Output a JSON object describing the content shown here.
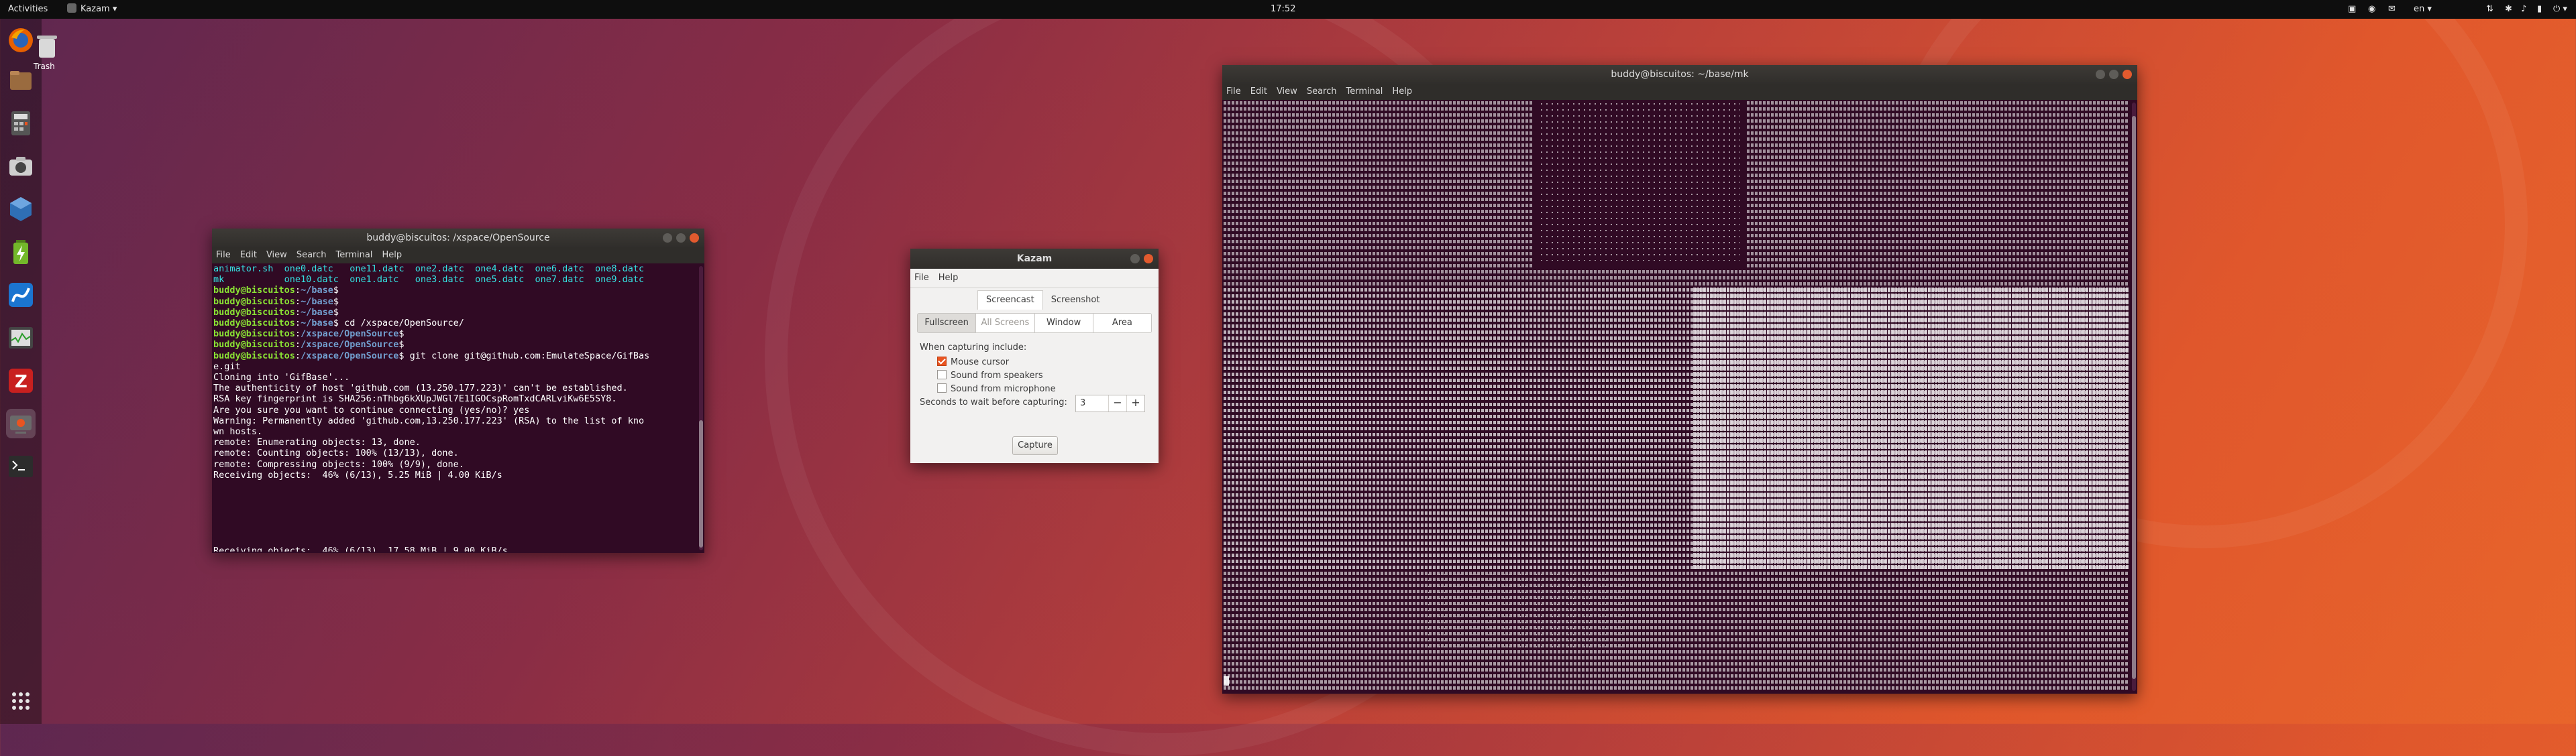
{
  "topbar": {
    "activities": "Activities",
    "app_menu": "Kazam",
    "clock": "17:52",
    "lang": "en",
    "colors": {
      "bg": "#0e0e0e",
      "text": "#e6e6e6"
    }
  },
  "desktop": {
    "trash_label": "Trash"
  },
  "dock": {
    "apps": [
      {
        "name": "firefox-icon",
        "color": "#e66000"
      },
      {
        "name": "files-icon",
        "color": "#9a6b3f"
      },
      {
        "name": "calculator-icon",
        "color": "#555555"
      },
      {
        "name": "screenshot-icon",
        "color": "#cccccc"
      },
      {
        "name": "virtualbox-icon",
        "color": "#2f6fb5"
      },
      {
        "name": "battery-icon",
        "color": "#73b82a"
      },
      {
        "name": "app-blue-icon",
        "color": "#1b75d0"
      },
      {
        "name": "system-monitor-icon",
        "color": "#444444"
      },
      {
        "name": "filezilla-icon",
        "color": "#c8201f"
      },
      {
        "name": "kazam-icon",
        "color": "#6a6a6a"
      },
      {
        "name": "terminal-icon",
        "color": "#2c2c2c"
      }
    ],
    "show_apps": "show-applications-icon"
  },
  "terminal_left": {
    "title": "buddy@biscuitos: /xspace/OpenSource",
    "menu": [
      "File",
      "Edit",
      "View",
      "Search",
      "Terminal",
      "Help"
    ],
    "lines": [
      {
        "type": "plain",
        "text": "animator.sh  one0.datc   one11.datc  one2.datc  one4.datc  one6.datc  one8.datc"
      },
      {
        "type": "plain",
        "text": "mk           one10.datc  one1.datc   one3.datc  one5.datc  one7.datc  one9.datc"
      },
      {
        "type": "prompt",
        "user": "buddy@biscuitos",
        "path": "~/base",
        "cmd": ""
      },
      {
        "type": "prompt",
        "user": "buddy@biscuitos",
        "path": "~/base",
        "cmd": ""
      },
      {
        "type": "prompt",
        "user": "buddy@biscuitos",
        "path": "~/base",
        "cmd": ""
      },
      {
        "type": "prompt",
        "user": "buddy@biscuitos",
        "path": "~/base",
        "cmd": " cd /xspace/OpenSource/"
      },
      {
        "type": "prompt",
        "user": "buddy@biscuitos",
        "path": "/xspace/OpenSource",
        "cmd": ""
      },
      {
        "type": "prompt",
        "user": "buddy@biscuitos",
        "path": "/xspace/OpenSource",
        "cmd": ""
      },
      {
        "type": "prompt",
        "user": "buddy@biscuitos",
        "path": "/xspace/OpenSource",
        "cmd": " git clone git@github.com:EmulateSpace/GifBas"
      },
      {
        "type": "plain",
        "text": "e.git"
      },
      {
        "type": "plain",
        "text": "Cloning into 'GifBase'..."
      },
      {
        "type": "plain",
        "text": "The authenticity of host 'github.com (13.250.177.223)' can't be established."
      },
      {
        "type": "plain",
        "text": "RSA key fingerprint is SHA256:nThbg6kXUpJWGl7E1IGOCspRomTxdCARLviKw6E5SY8."
      },
      {
        "type": "plain",
        "text": "Are you sure you want to continue connecting (yes/no)? yes"
      },
      {
        "type": "plain",
        "text": "Warning: Permanently added 'github.com,13.250.177.223' (RSA) to the list of kno"
      },
      {
        "type": "plain",
        "text": "wn hosts."
      },
      {
        "type": "plain",
        "text": "remote: Enumerating objects: 13, done."
      },
      {
        "type": "plain",
        "text": "remote: Counting objects: 100% (13/13), done."
      },
      {
        "type": "plain",
        "text": "remote: Compressing objects: 100% (9/9), done."
      },
      {
        "type": "plain",
        "text": "Receiving objects:  46% (6/13), 5.25 MiB | 4.00 KiB/s"
      },
      {
        "type": "plain",
        "text": ""
      },
      {
        "type": "plain",
        "text": ""
      },
      {
        "type": "plain",
        "text": ""
      },
      {
        "type": "plain",
        "text": ""
      },
      {
        "type": "plain",
        "text": ""
      },
      {
        "type": "plain",
        "text": ""
      },
      {
        "type": "plain",
        "text": "Receiving objects:  46% (6/13), 17.58 MiB | 9.00 KiB/s"
      }
    ]
  },
  "terminal_right": {
    "title": "buddy@biscuitos: ~/base/mk",
    "menu": [
      "File",
      "Edit",
      "View",
      "Search",
      "Terminal",
      "Help"
    ]
  },
  "kazam": {
    "title": "Kazam",
    "menu": [
      "File",
      "Help"
    ],
    "tabs": [
      "Screencast",
      "Screenshot"
    ],
    "modes": [
      "Fullscreen",
      "All Screens",
      "Window",
      "Area"
    ],
    "capturing_label": "When capturing include:",
    "options": [
      {
        "label": "Mouse cursor",
        "checked": true
      },
      {
        "label": "Sound from speakers",
        "checked": false
      },
      {
        "label": "Sound from microphone",
        "checked": false
      }
    ],
    "wait_label": "Seconds to wait before capturing:",
    "wait_value": "3",
    "capture_button": "Capture"
  }
}
